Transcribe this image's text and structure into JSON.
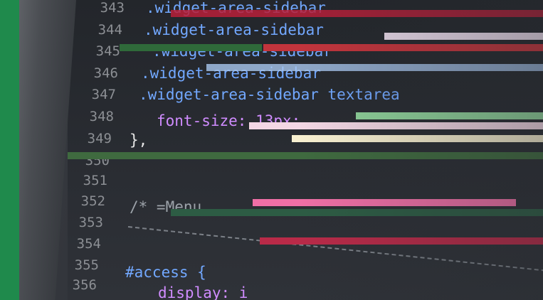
{
  "line_numbers": [
    "343",
    "344",
    "345",
    "346",
    "347",
    "348",
    "349",
    "350",
    "351",
    "352",
    "353",
    "354",
    "355",
    "356"
  ],
  "code_lines": [
    ".widget-area-sidebar",
    ".widget-area-sidebar",
    ".widget-area-sidebar",
    ".widget-area-sidebar",
    ".widget-area-sidebar textarea",
    "font-size: 13px;",
    "},",
    "/* =Menu",
    "#access {",
    "display: i"
  ],
  "colors": {
    "accent_green": "#1f8a4c",
    "selector_blue": "#6aa7ff",
    "property_pink": "#d08cff"
  }
}
